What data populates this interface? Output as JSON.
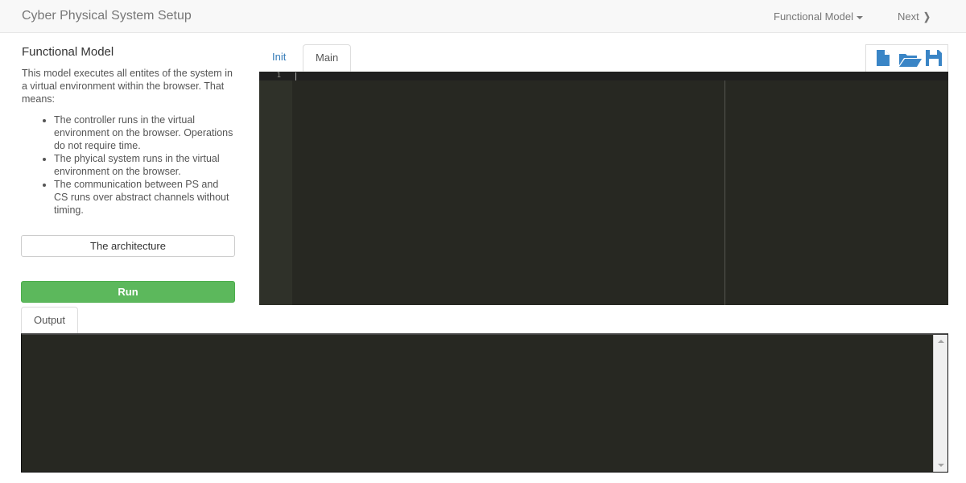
{
  "navbar": {
    "brand": "Cyber Physical System Setup",
    "model_dropdown": "Functional Model",
    "next": "Next"
  },
  "sidebar": {
    "title": "Functional Model",
    "description": "This model executes all entites of the system in a virtual environment within the browser. That means:",
    "bullets": [
      "The controller runs in the virtual environment on the browser. Operations do not require time.",
      "The phyical system runs in the virtual environment on the browser.",
      "The communication between PS and CS runs over abstract channels without timing."
    ],
    "architecture_button": "The architecture",
    "run_button": "Run"
  },
  "editor": {
    "tabs": [
      {
        "label": "Init",
        "active": false
      },
      {
        "label": "Main",
        "active": true
      }
    ],
    "toolbar_icons": [
      "new-file-icon",
      "open-folder-icon",
      "save-icon"
    ],
    "line_numbers": [
      "1"
    ],
    "content": ""
  },
  "output": {
    "tab_label": "Output",
    "content": ""
  },
  "colors": {
    "accent": "#337ab7",
    "run_green": "#5cb85c",
    "editor_bg": "#272822",
    "icon_blue": "#3a85c6"
  }
}
